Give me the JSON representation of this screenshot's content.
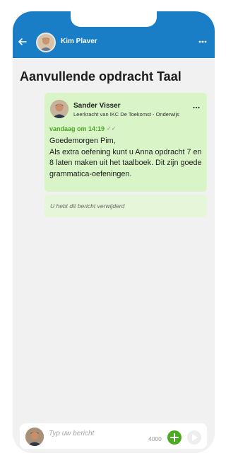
{
  "header": {
    "contact_name": "Kim Plaver",
    "background": "#1a7ec6"
  },
  "page": {
    "title": "Aanvullende opdracht Taal"
  },
  "message": {
    "sender_name": "Sander Visser",
    "sender_role": "Leerkracht van IKC De Toekomst - Onderwijs",
    "timestamp": "vandaag om 14:19",
    "read_status": "✓✓",
    "body_lines": [
      "Goedemorgen Pim,",
      "Als extra oefening kunt u Anna opdracht 7 en 8 laten maken uit het taalboek. Dit zijn goede grammatica-oefeningen."
    ],
    "card_color": "#d9f5c8"
  },
  "deleted_message": {
    "text": "U hebt dit bericht verwijderd"
  },
  "composer": {
    "placeholder": "Typ uw bericht",
    "char_count": "4000",
    "add_color": "#4aaa22"
  },
  "icons": {
    "back": "arrow-left-icon",
    "more": "more-horizontal-icon",
    "add": "plus-icon",
    "send": "send-icon"
  }
}
